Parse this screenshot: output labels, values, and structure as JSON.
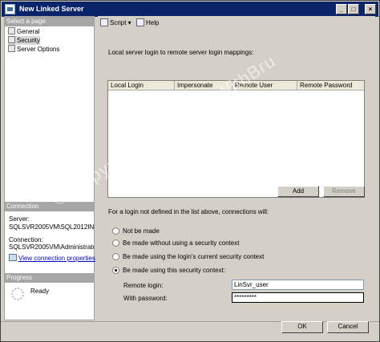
{
  "window": {
    "title": "New Linked Server"
  },
  "left": {
    "select_header": "Select a page",
    "pages": [
      "General",
      "Security",
      "Server Options"
    ],
    "connection_header": "Connection",
    "server_label": "Server:",
    "server_value": "SQLSVR2005VM\\SQL2012INSTA",
    "connection_label": "Connection:",
    "connection_value": "SQLSVR2005VM\\Administrator",
    "view_link": "View connection properties",
    "progress_header": "Progress",
    "progress_status": "Ready"
  },
  "toolbar": {
    "script": "Script",
    "help": "Help"
  },
  "mappings": {
    "heading": "Local server login to remote server login mappings:",
    "columns": [
      "Local Login",
      "Impersonate",
      "Remote User",
      "Remote Password"
    ],
    "add": "Add",
    "remove": "Remove"
  },
  "options": {
    "heading": "For a login not defined in the list above, connections will:",
    "choices": [
      "Not be made",
      "Be made without using a security context",
      "Be made using the login's current security context",
      "Be made using this security context:"
    ],
    "selected_index": 3,
    "remote_login_label": "Remote login:",
    "remote_login_value": "LinSvr_user",
    "password_label": "With password:",
    "password_value": "*********"
  },
  "footer": {
    "ok": "OK",
    "cancel": "Cancel"
  },
  "watermark": "© Copyright LearnSQLWithBru"
}
